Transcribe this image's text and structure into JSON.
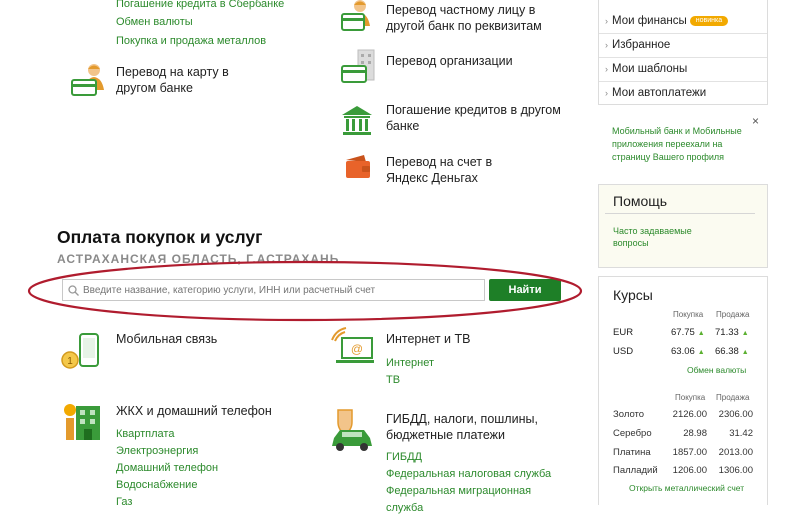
{
  "top_left_links": [
    "Погашение кредита в Сбербанке",
    "Обмен валюты",
    "Покупка и продажа металлов"
  ],
  "transfer_card": "Перевод на карту в другом банке",
  "transfer_private": "Перевод частному лицу в другой банк по реквизитам",
  "transfer_org": "Перевод организации",
  "repay_other": "Погашение кредитов в другом банке",
  "yandex": "Перевод на счет в Яндекс Деньгах",
  "payments": {
    "title": "Оплата покупок и услуг",
    "region": "АСТРАХАНСКАЯ ОБЛАСТЬ, Г.АСТРАХАНЬ",
    "search_placeholder": "Введите название, категорию услуги, ИНН или расчетный счет",
    "find_button": "Найти"
  },
  "categories": {
    "mobile": {
      "title": "Мобильная связь"
    },
    "internet": {
      "title": "Интернет и ТВ",
      "links": [
        "Интернет",
        "ТВ"
      ]
    },
    "housing": {
      "title": "ЖКХ и домашний телефон",
      "links": [
        "Квартплата",
        "Электроэнергия",
        "Домашний телефон",
        "Водоснабжение",
        "Газ"
      ]
    },
    "gibdd": {
      "title": "ГИБДД, налоги, пошлины, бюджетные платежи",
      "links": [
        "ГИБДД",
        "Федеральная налоговая служба",
        "Федеральная миграционная служба"
      ]
    }
  },
  "sidebar": {
    "menu": [
      "Мои финансы",
      "Избранное",
      "Мои шаблоны",
      "Мои автоплатежи"
    ],
    "new_badge": "новинка",
    "notice": "Мобильный банк и Мобильные приложения переехали на страницу Вашего профиля",
    "notice_close": "×",
    "help_title": "Помощь",
    "help_link": "Часто задаваемые вопросы"
  },
  "rates": {
    "title": "Курсы",
    "buy": "Покупка",
    "sell": "Продажа",
    "currencies": [
      {
        "code": "EUR",
        "buy": "67.75",
        "sell": "71.33"
      },
      {
        "code": "USD",
        "buy": "63.06",
        "sell": "66.38"
      }
    ],
    "exchange_link": "Обмен валюты",
    "metals": [
      {
        "name": "Золото",
        "buy": "2126.00",
        "sell": "2306.00"
      },
      {
        "name": "Серебро",
        "buy": "28.98",
        "sell": "31.42"
      },
      {
        "name": "Платина",
        "buy": "1857.00",
        "sell": "2013.00"
      },
      {
        "name": "Палладий",
        "buy": "1206.00",
        "sell": "1306.00"
      }
    ],
    "metal_account_link": "Открыть металлический счет"
  },
  "colors": {
    "accent": "#2c8a2c",
    "button": "#1e7f27",
    "annotation": "#b01c2e",
    "badge": "#f2a900"
  }
}
